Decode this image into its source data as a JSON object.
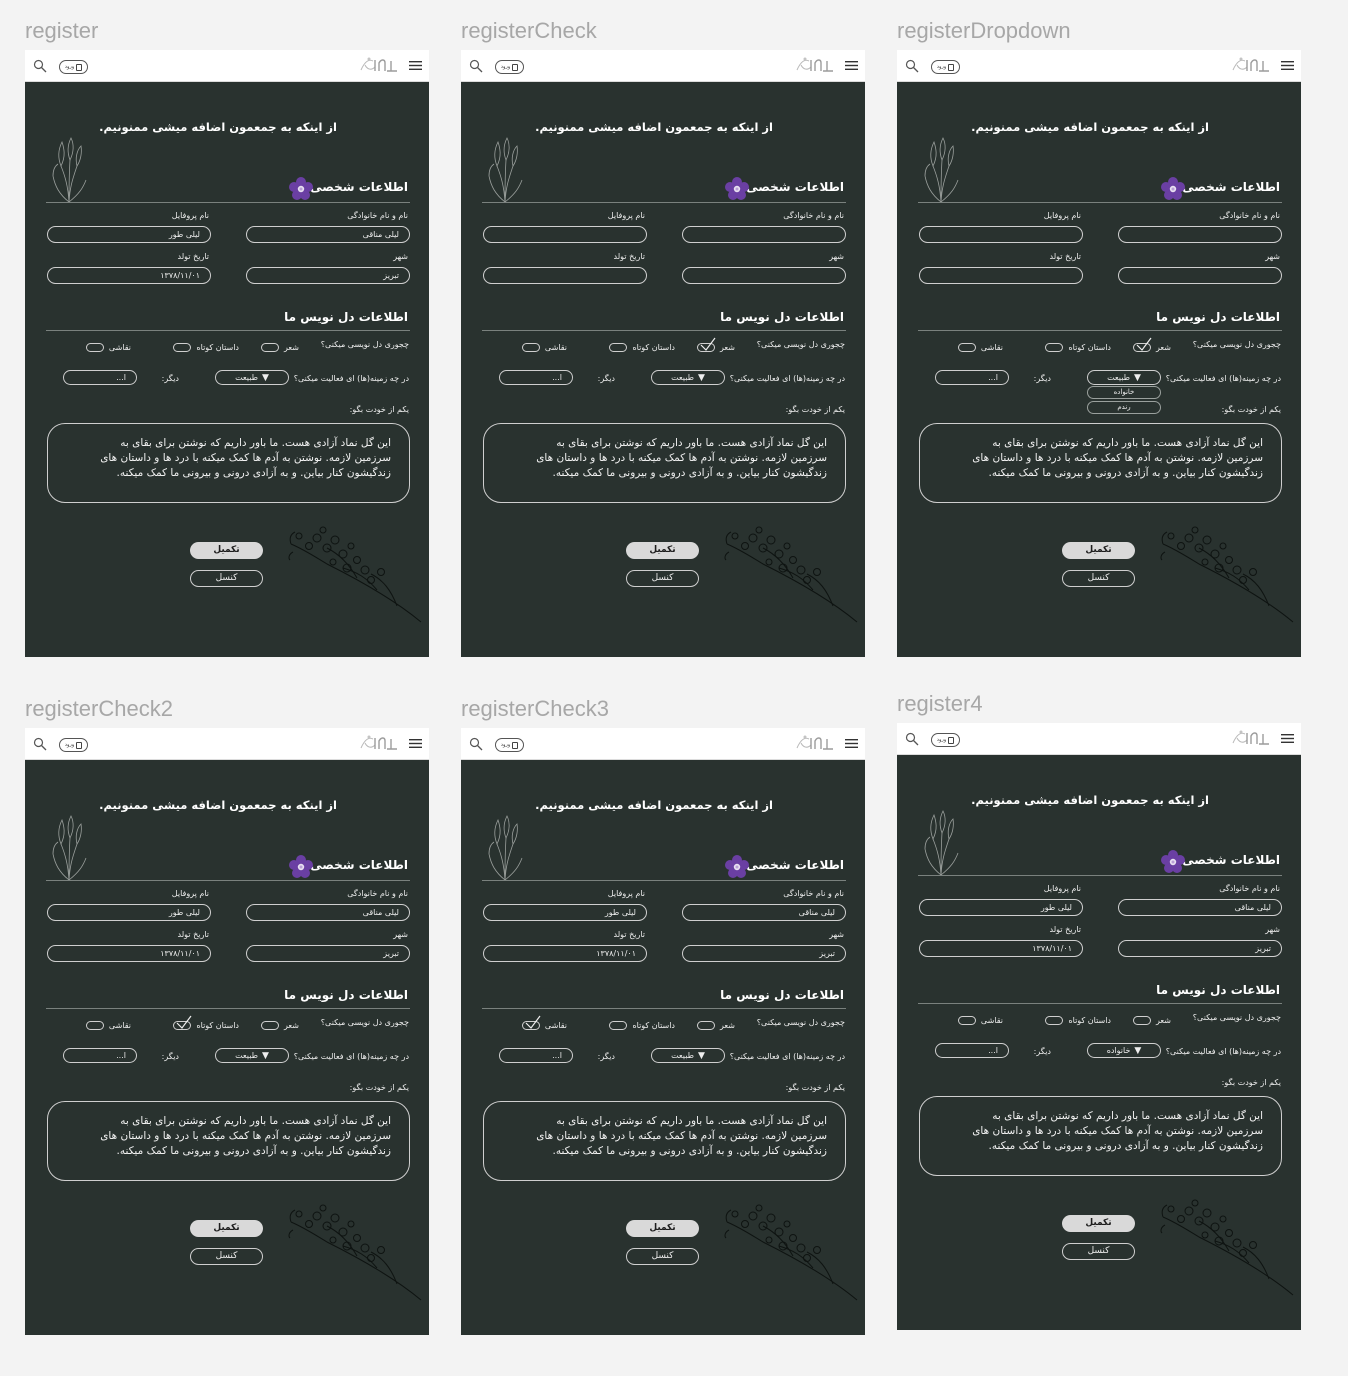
{
  "frames": [
    {
      "label": "register",
      "checked": "",
      "dropdown": "طبیعت",
      "dd_open": false,
      "filled": true
    },
    {
      "label": "registerCheck",
      "checked": "poem",
      "dropdown": "طبیعت",
      "dd_open": false,
      "filled": false
    },
    {
      "label": "registerDropdown",
      "checked": "poem",
      "dropdown": "طبیعت",
      "dd_open": true,
      "filled": false
    },
    {
      "label": "registerCheck2",
      "checked": "story",
      "dropdown": "طبیعت",
      "dd_open": false,
      "filled": true
    },
    {
      "label": "registerCheck3",
      "checked": "paint",
      "dropdown": "طبیعت",
      "dd_open": false,
      "filled": true
    },
    {
      "label": "register4",
      "checked": "",
      "dropdown": "خانواده",
      "dd_open": false,
      "filled": true
    }
  ],
  "header": {
    "login_label": "ورود",
    "logo": "logo-icon"
  },
  "form": {
    "welcome": "از اینکه به جمعمون اضافه میشی ممنونیم.",
    "personal_title": "اطلاعات شخصی",
    "name_label": "نام و نام خانوادگی",
    "profile_label": "نام پروفایل",
    "city_label": "شهر",
    "birth_label": "تاریخ تولد",
    "name_value": "لیلی مناقی",
    "profile_value": "لیلی طور",
    "city_value": "تبریز",
    "birth_value": "۱۳۷۸/۱۱/۰۱",
    "writing_title": "اطلاعات دل نویس ما",
    "how_q": "چجوری دل نویسی میکنی؟",
    "opt_poem": "شعر",
    "opt_story": "داستان کوتاه",
    "opt_paint": "نقاشی",
    "field_q": "در چه زمینه(ها) ای فعالیت میکنی؟",
    "dd_opt_family": "خانواده",
    "dd_opt_random": "رندم",
    "other_label": "دیگر:",
    "other_value": "ا...",
    "about_label": "یکم از خودت بگو:",
    "about_line1": "این گل نماد آزادی هست. ما باور داریم که نوشتن برای بقای به",
    "about_line2": "سرزمین لازمه. نوشتن به آدم ها کمک میکنه با درد ها و داستان های",
    "about_line3": "زندگیشون کنار بیاین. و به آزادی درونی و بیرونی ما کمک میکنه.",
    "complete_label": "تکمیل",
    "cancel_label": "کنسل"
  },
  "colors": {
    "frame_bg": "#29322f",
    "accent_flower": "#6a3fa3",
    "page_bg": "#f3f3f3"
  }
}
